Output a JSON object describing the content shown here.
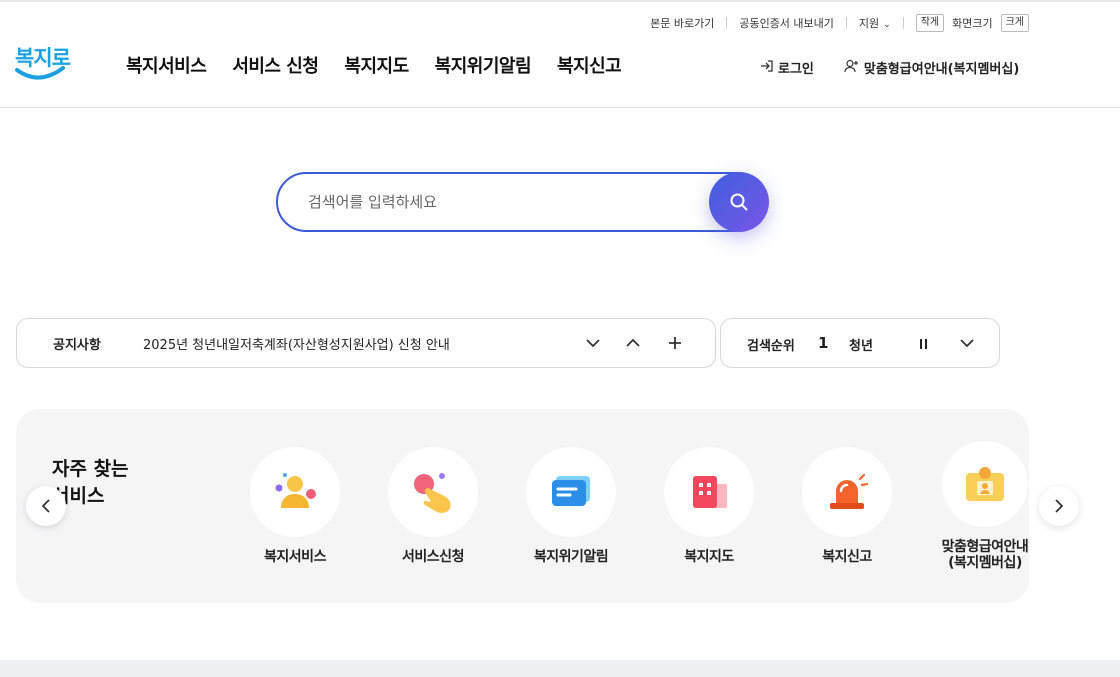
{
  "header": {
    "logo_text": "복지로",
    "util_links": {
      "skip": "본문 바로가기",
      "cert": "공동인증서 내보내기",
      "support": "지원",
      "font_small": "작게",
      "font_label": "화면크기",
      "font_large": "크게"
    },
    "nav": [
      "복지서비스",
      "서비스 신청",
      "복지지도",
      "복지위기알림",
      "복지신고"
    ],
    "login": "로그인",
    "membership": "맞춤형급여안내(복지멤버십)"
  },
  "search": {
    "placeholder": "검색어를 입력하세요"
  },
  "notice": {
    "label": "공지사항",
    "text": "2025년 청년내일저축계좌(자산형성지원사업) 신청 안내"
  },
  "ranking": {
    "label": "검색순위",
    "rank": "1",
    "keyword": "청년"
  },
  "frequent": {
    "title": "자주 찾는 서비스",
    "items": [
      {
        "label": "복지서비스",
        "icon": "person-icon"
      },
      {
        "label": "서비스신청",
        "icon": "tap-hand-icon"
      },
      {
        "label": "복지위기알림",
        "icon": "message-icon"
      },
      {
        "label": "복지지도",
        "icon": "building-icon"
      },
      {
        "label": "복지신고",
        "icon": "siren-icon"
      },
      {
        "label": "맞춤형급여안내\n(복지멤버십)",
        "icon": "member-card-icon"
      }
    ]
  },
  "colors": {
    "brand": "#1aa2e0",
    "search_border": "#3b5bd6",
    "search_button": "#5b57e2"
  }
}
